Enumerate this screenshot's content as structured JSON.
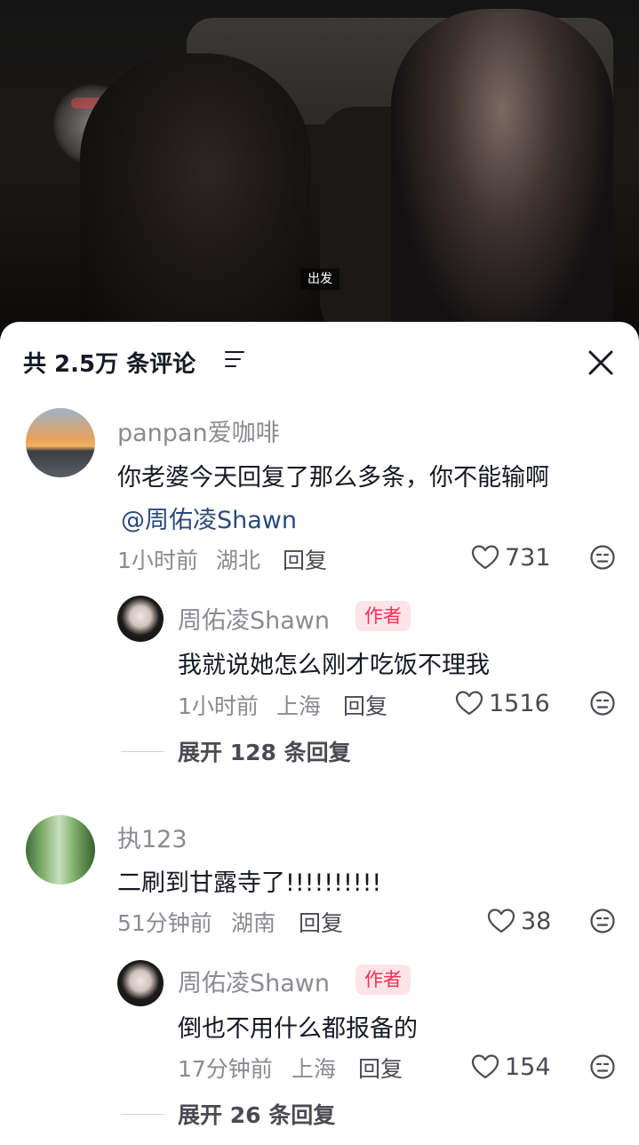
{
  "video": {
    "caption": "出发"
  },
  "header": {
    "count_label": "共 2.5万 条评论"
  },
  "comments": [
    {
      "name": "panpan爱咖啡",
      "text": "你老婆今天回复了那么多条，你不能输啊",
      "mention": "@周佑凌Shawn",
      "time": "1小时前",
      "location": "湖北",
      "reply_label": "回复",
      "likes": "731",
      "reply": {
        "name": "周佑凌Shawn",
        "badge": "作者",
        "text": "我就说她怎么刚才吃饭不理我",
        "time": "1小时前",
        "location": "上海",
        "reply_label": "回复",
        "likes": "1516"
      },
      "expand_label": "展开 128 条回复"
    },
    {
      "name": "执123",
      "text": "二刷到甘露寺了!!!!!!!!!!",
      "time": "51分钟前",
      "location": "湖南",
      "reply_label": "回复",
      "likes": "38",
      "reply": {
        "name": "周佑凌Shawn",
        "badge": "作者",
        "text": "倒也不用什么都报备的",
        "time": "17分钟前",
        "location": "上海",
        "reply_label": "回复",
        "likes": "154"
      },
      "expand_label": "展开 26 条回复"
    }
  ],
  "colors": {
    "author_badge": "#fe2c55",
    "mention": "#2b4a7a"
  }
}
